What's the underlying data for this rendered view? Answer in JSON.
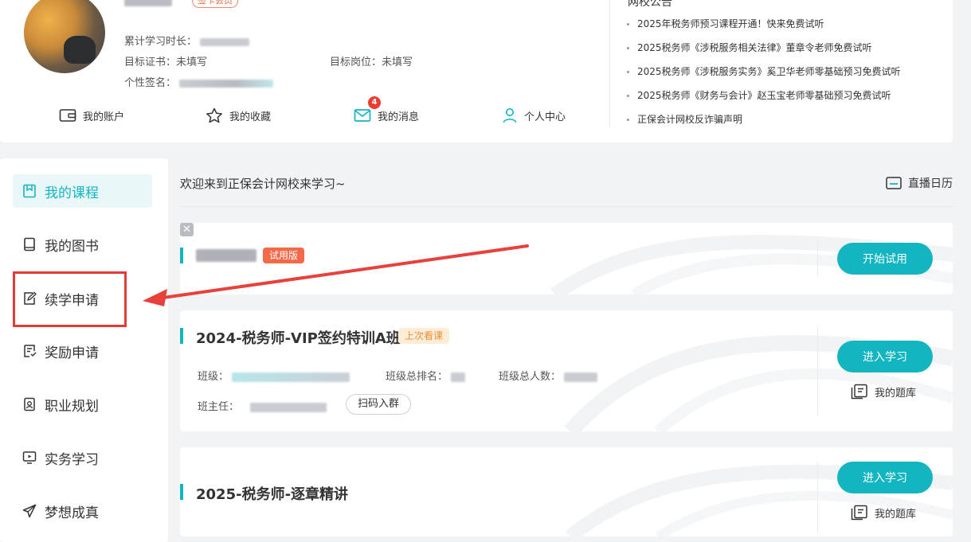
{
  "profile": {
    "vip_badge": "签卡会员",
    "study_time_label": "累计学习时长：",
    "target_cert_label": "目标证书：",
    "target_cert_value": "未填写",
    "target_job_label": "目标岗位：",
    "target_job_value": "未填写",
    "signature_label": "个性签名："
  },
  "shortcuts": [
    {
      "label": "我的账户",
      "icon": "wallet-icon"
    },
    {
      "label": "我的收藏",
      "icon": "star-icon"
    },
    {
      "label": "我的消息",
      "icon": "mail-icon"
    },
    {
      "label": "个人中心",
      "icon": "user-icon"
    }
  ],
  "message_count": "4",
  "notices": {
    "title": "网校公告",
    "items": [
      "2025年税务师预习课程开通！快来免费试听",
      "2025税务师《涉税服务相关法律》董章令老师免费试听",
      "2025税务师《涉税服务实务》奚卫华老师零基础预习免费试听",
      "2025税务师《财务与会计》赵玉宝老师零基础预习免费试听",
      "正保会计网校反诈骗声明"
    ]
  },
  "nav": {
    "items": [
      {
        "label": "我的课程",
        "icon": "bookmark-icon",
        "active": true
      },
      {
        "label": "我的图书",
        "icon": "book-icon"
      },
      {
        "label": "续学申请",
        "icon": "edit-icon"
      },
      {
        "label": "奖励申请",
        "icon": "reward-doc-icon"
      },
      {
        "label": "职业规划",
        "icon": "badge-icon"
      },
      {
        "label": "实务学习",
        "icon": "monitor-icon"
      },
      {
        "label": "梦想成真",
        "icon": "paper-plane-icon"
      }
    ]
  },
  "main": {
    "welcome": "欢迎来到正保会计网校来学习~",
    "calendar_label": "直播日历"
  },
  "cards": [
    {
      "tag": "试用版",
      "button": "开始试用"
    },
    {
      "title": "2024-税务师-VIP签约特训A班",
      "tag": "上次看课",
      "class_label": "班级：",
      "rank_label": "班级总排名：",
      "total_label": "班级总人数：",
      "teacher_label": "班主任：",
      "qr_button": "扫码入群",
      "button": "进入学习",
      "qbank": "我的题库"
    },
    {
      "title": "2025-税务师-逐章精讲",
      "button": "进入学习",
      "qbank": "我的题库"
    }
  ],
  "colors": {
    "accent": "#13b5c1",
    "highlight": "#e53935",
    "trial_tag": "#f26a4a",
    "badge": "#ef3b32"
  }
}
